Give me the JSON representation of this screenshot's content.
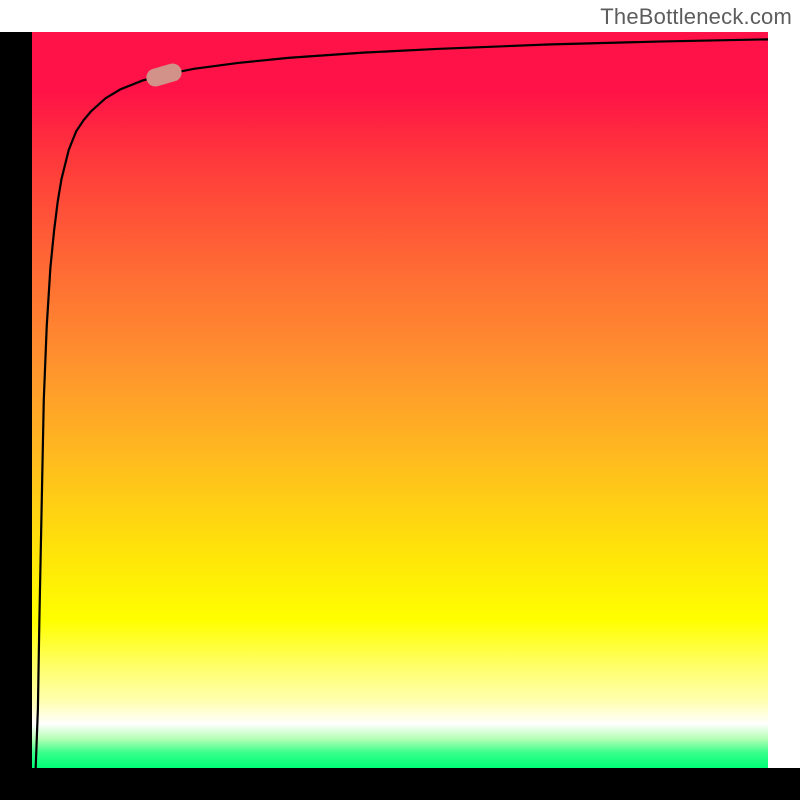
{
  "watermark": "TheBottleneck.com",
  "chart_data": {
    "type": "line",
    "title": "",
    "xlabel": "",
    "ylabel": "",
    "xlim": [
      0,
      100
    ],
    "ylim": [
      0,
      100
    ],
    "grid": false,
    "legend": false,
    "background_gradient": {
      "direction": "vertical",
      "stops": [
        {
          "pos": 0,
          "color": "#ff1247"
        },
        {
          "pos": 80,
          "color": "#ffff00"
        },
        {
          "pos": 94,
          "color": "#ffffff"
        },
        {
          "pos": 100,
          "color": "#00ff77"
        }
      ]
    },
    "series": [
      {
        "name": "main-curve",
        "x": [
          0.5,
          0.8,
          1.0,
          1.3,
          1.6,
          2.0,
          2.5,
          3.0,
          3.5,
          4.0,
          5.0,
          6.0,
          7.0,
          8.0,
          10.0,
          12.0,
          15.0,
          18.0,
          22.0,
          28.0,
          35.0,
          45.0,
          55.0,
          70.0,
          85.0,
          100.0
        ],
        "y": [
          0.0,
          8.0,
          20.0,
          35.0,
          50.0,
          60.0,
          68.0,
          73.0,
          77.0,
          80.0,
          84.0,
          86.5,
          88.0,
          89.2,
          91.0,
          92.2,
          93.4,
          94.2,
          95.0,
          95.8,
          96.5,
          97.2,
          97.7,
          98.3,
          98.7,
          99.0
        ]
      }
    ],
    "marker": {
      "x": 18,
      "y": 94.2,
      "angle_deg": -16
    }
  }
}
